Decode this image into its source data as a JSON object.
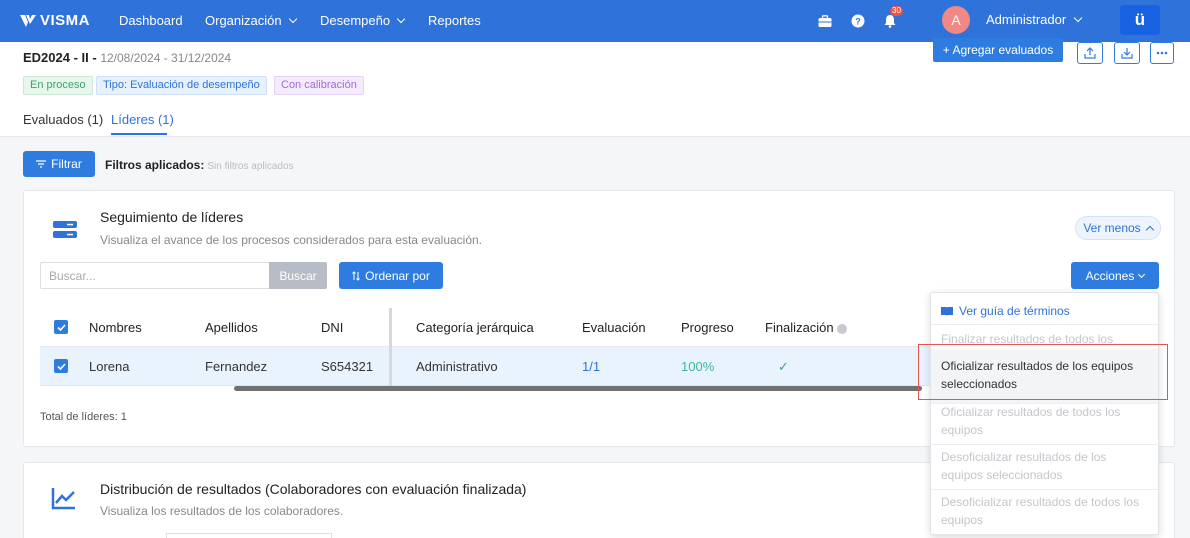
{
  "nav": {
    "brand": "VISMA",
    "items": [
      {
        "label": "Dashboard",
        "has_dropdown": false
      },
      {
        "label": "Organización",
        "has_dropdown": true
      },
      {
        "label": "Desempeño",
        "has_dropdown": true
      },
      {
        "label": "Reportes",
        "has_dropdown": false
      }
    ],
    "notification_count": "30",
    "avatar_initial": "A",
    "user_name": "Administrador",
    "app_logo": "ü"
  },
  "evaluation": {
    "code": "ED2024 - II -",
    "dates": "12/08/2024 - 31/12/2024",
    "tags": [
      "En proceso",
      "Tipo: Evaluación de desempeño",
      "Con calibración"
    ],
    "add_button": "+ Agregar evaluados",
    "tabs": [
      {
        "label": "Evaluados (1)",
        "active": false
      },
      {
        "label": "Líderes (1)",
        "active": true
      }
    ]
  },
  "filters": {
    "button": "Filtrar",
    "applied_label": "Filtros aplicados:",
    "applied_value": "Sin filtros aplicados"
  },
  "leaders_card": {
    "title": "Seguimiento de líderes",
    "subtitle": "Visualiza el avance de los procesos considerados para esta evaluación.",
    "toggle": "Ver menos",
    "search_placeholder": "Buscar...",
    "search_button": "Buscar",
    "sort_button": "Ordenar por",
    "actions_button": "Acciones",
    "table": {
      "headers": [
        "Nombres",
        "Apellidos",
        "DNI",
        "Categoría jerárquica",
        "Evaluación",
        "Progreso",
        "Finalización"
      ],
      "rows": [
        {
          "nombres": "Lorena",
          "apellidos": "Fernandez",
          "dni": "S654321",
          "categoria": "Administrativo",
          "evaluacion": "1/1",
          "progreso": "100%",
          "finalizacion": "✓"
        }
      ]
    },
    "total": "Total de líderes: 1"
  },
  "distribution_card": {
    "title": "Distribución de resultados",
    "title_suffix": " (Colaboradores con evaluación finalizada)",
    "subtitle": "Visualiza los resultados de los colaboradores."
  },
  "actions_menu": {
    "guide_link": "Ver guía de términos",
    "items": [
      {
        "label": "Finalizar resultados de todos los equipos",
        "enabled": false
      },
      {
        "label": "Oficializar resultados de los equipos seleccionados",
        "enabled": true,
        "highlighted": true
      },
      {
        "label": "Oficializar resultados de todos los equipos",
        "enabled": false
      },
      {
        "label": "Desoficializar resultados de los equipos seleccionados",
        "enabled": false
      },
      {
        "label": "Desoficializar resultados de todos los equipos",
        "enabled": false
      }
    ]
  },
  "colors": {
    "primary": "#2f72d9",
    "highlight_border": "#e25555",
    "progress_green": "#3aa56a"
  }
}
